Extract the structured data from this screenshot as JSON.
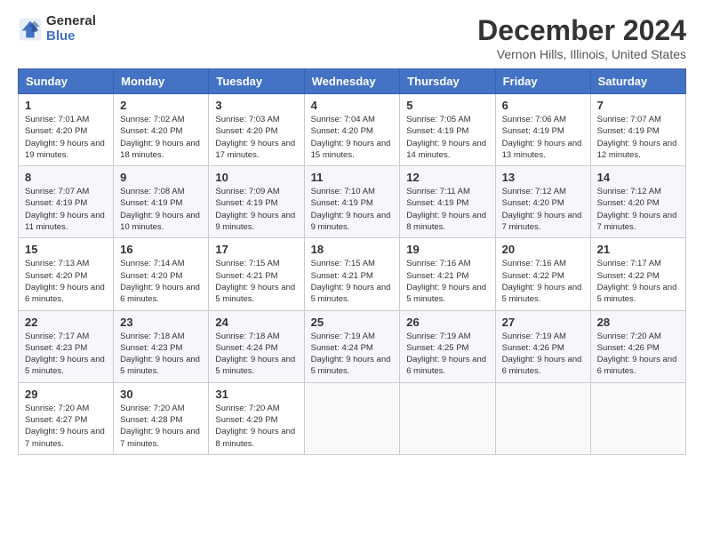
{
  "header": {
    "logo_general": "General",
    "logo_blue": "Blue",
    "title": "December 2024",
    "location": "Vernon Hills, Illinois, United States"
  },
  "calendar": {
    "days_of_week": [
      "Sunday",
      "Monday",
      "Tuesday",
      "Wednesday",
      "Thursday",
      "Friday",
      "Saturday"
    ],
    "weeks": [
      [
        {
          "day": "1",
          "sunrise": "7:01 AM",
          "sunset": "4:20 PM",
          "daylight": "9 hours and 19 minutes."
        },
        {
          "day": "2",
          "sunrise": "7:02 AM",
          "sunset": "4:20 PM",
          "daylight": "9 hours and 18 minutes."
        },
        {
          "day": "3",
          "sunrise": "7:03 AM",
          "sunset": "4:20 PM",
          "daylight": "9 hours and 17 minutes."
        },
        {
          "day": "4",
          "sunrise": "7:04 AM",
          "sunset": "4:20 PM",
          "daylight": "9 hours and 15 minutes."
        },
        {
          "day": "5",
          "sunrise": "7:05 AM",
          "sunset": "4:19 PM",
          "daylight": "9 hours and 14 minutes."
        },
        {
          "day": "6",
          "sunrise": "7:06 AM",
          "sunset": "4:19 PM",
          "daylight": "9 hours and 13 minutes."
        },
        {
          "day": "7",
          "sunrise": "7:07 AM",
          "sunset": "4:19 PM",
          "daylight": "9 hours and 12 minutes."
        }
      ],
      [
        {
          "day": "8",
          "sunrise": "7:07 AM",
          "sunset": "4:19 PM",
          "daylight": "9 hours and 11 minutes."
        },
        {
          "day": "9",
          "sunrise": "7:08 AM",
          "sunset": "4:19 PM",
          "daylight": "9 hours and 10 minutes."
        },
        {
          "day": "10",
          "sunrise": "7:09 AM",
          "sunset": "4:19 PM",
          "daylight": "9 hours and 9 minutes."
        },
        {
          "day": "11",
          "sunrise": "7:10 AM",
          "sunset": "4:19 PM",
          "daylight": "9 hours and 9 minutes."
        },
        {
          "day": "12",
          "sunrise": "7:11 AM",
          "sunset": "4:19 PM",
          "daylight": "9 hours and 8 minutes."
        },
        {
          "day": "13",
          "sunrise": "7:12 AM",
          "sunset": "4:20 PM",
          "daylight": "9 hours and 7 minutes."
        },
        {
          "day": "14",
          "sunrise": "7:12 AM",
          "sunset": "4:20 PM",
          "daylight": "9 hours and 7 minutes."
        }
      ],
      [
        {
          "day": "15",
          "sunrise": "7:13 AM",
          "sunset": "4:20 PM",
          "daylight": "9 hours and 6 minutes."
        },
        {
          "day": "16",
          "sunrise": "7:14 AM",
          "sunset": "4:20 PM",
          "daylight": "9 hours and 6 minutes."
        },
        {
          "day": "17",
          "sunrise": "7:15 AM",
          "sunset": "4:21 PM",
          "daylight": "9 hours and 5 minutes."
        },
        {
          "day": "18",
          "sunrise": "7:15 AM",
          "sunset": "4:21 PM",
          "daylight": "9 hours and 5 minutes."
        },
        {
          "day": "19",
          "sunrise": "7:16 AM",
          "sunset": "4:21 PM",
          "daylight": "9 hours and 5 minutes."
        },
        {
          "day": "20",
          "sunrise": "7:16 AM",
          "sunset": "4:22 PM",
          "daylight": "9 hours and 5 minutes."
        },
        {
          "day": "21",
          "sunrise": "7:17 AM",
          "sunset": "4:22 PM",
          "daylight": "9 hours and 5 minutes."
        }
      ],
      [
        {
          "day": "22",
          "sunrise": "7:17 AM",
          "sunset": "4:23 PM",
          "daylight": "9 hours and 5 minutes."
        },
        {
          "day": "23",
          "sunrise": "7:18 AM",
          "sunset": "4:23 PM",
          "daylight": "9 hours and 5 minutes."
        },
        {
          "day": "24",
          "sunrise": "7:18 AM",
          "sunset": "4:24 PM",
          "daylight": "9 hours and 5 minutes."
        },
        {
          "day": "25",
          "sunrise": "7:19 AM",
          "sunset": "4:24 PM",
          "daylight": "9 hours and 5 minutes."
        },
        {
          "day": "26",
          "sunrise": "7:19 AM",
          "sunset": "4:25 PM",
          "daylight": "9 hours and 6 minutes."
        },
        {
          "day": "27",
          "sunrise": "7:19 AM",
          "sunset": "4:26 PM",
          "daylight": "9 hours and 6 minutes."
        },
        {
          "day": "28",
          "sunrise": "7:20 AM",
          "sunset": "4:26 PM",
          "daylight": "9 hours and 6 minutes."
        }
      ],
      [
        {
          "day": "29",
          "sunrise": "7:20 AM",
          "sunset": "4:27 PM",
          "daylight": "9 hours and 7 minutes."
        },
        {
          "day": "30",
          "sunrise": "7:20 AM",
          "sunset": "4:28 PM",
          "daylight": "9 hours and 7 minutes."
        },
        {
          "day": "31",
          "sunrise": "7:20 AM",
          "sunset": "4:29 PM",
          "daylight": "9 hours and 8 minutes."
        },
        null,
        null,
        null,
        null
      ]
    ]
  }
}
